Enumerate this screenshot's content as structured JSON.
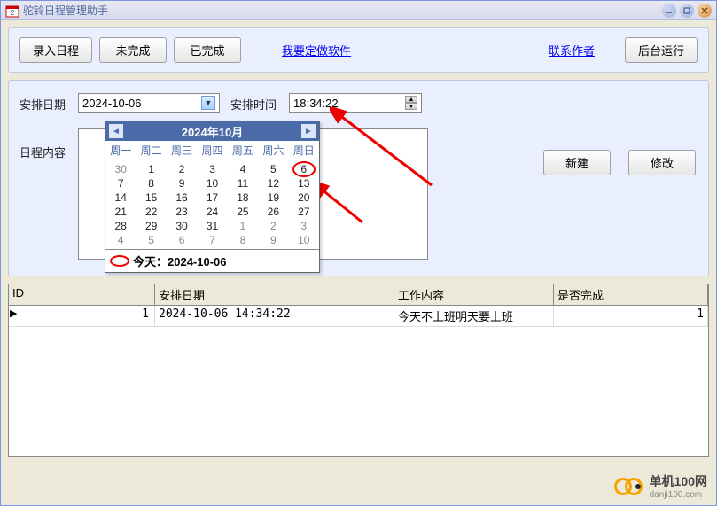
{
  "window": {
    "title": "驼铃日程管理助手"
  },
  "toolbar": {
    "input_schedule": "录入日程",
    "incomplete": "未完成",
    "complete": "已完成",
    "custom_sw": "我要定做软件",
    "contact": "联系作者",
    "background": "后台运行"
  },
  "form": {
    "date_label": "安排日期",
    "date_value": "2024-10-06",
    "time_label": "安排时间",
    "time_value": "18:34:22",
    "content_label": "日程内容",
    "new_btn": "新建",
    "edit_btn": "修改"
  },
  "calendar": {
    "title": "2024年10月",
    "weekdays": [
      "周一",
      "周二",
      "周三",
      "周四",
      "周五",
      "周六",
      "周日"
    ],
    "days": [
      {
        "n": "30",
        "other": true
      },
      {
        "n": "1"
      },
      {
        "n": "2"
      },
      {
        "n": "3"
      },
      {
        "n": "4"
      },
      {
        "n": "5"
      },
      {
        "n": "6",
        "selected": true
      },
      {
        "n": "7"
      },
      {
        "n": "8"
      },
      {
        "n": "9"
      },
      {
        "n": "10"
      },
      {
        "n": "11"
      },
      {
        "n": "12"
      },
      {
        "n": "13"
      },
      {
        "n": "14"
      },
      {
        "n": "15"
      },
      {
        "n": "16"
      },
      {
        "n": "17"
      },
      {
        "n": "18"
      },
      {
        "n": "19"
      },
      {
        "n": "20"
      },
      {
        "n": "21"
      },
      {
        "n": "22"
      },
      {
        "n": "23"
      },
      {
        "n": "24"
      },
      {
        "n": "25"
      },
      {
        "n": "26"
      },
      {
        "n": "27"
      },
      {
        "n": "28"
      },
      {
        "n": "29"
      },
      {
        "n": "30"
      },
      {
        "n": "31"
      },
      {
        "n": "1",
        "other": true
      },
      {
        "n": "2",
        "other": true
      },
      {
        "n": "3",
        "other": true
      },
      {
        "n": "4",
        "other": true
      },
      {
        "n": "5",
        "other": true
      },
      {
        "n": "6",
        "other": true
      },
      {
        "n": "7",
        "other": true
      },
      {
        "n": "8",
        "other": true
      },
      {
        "n": "9",
        "other": true
      },
      {
        "n": "10",
        "other": true
      }
    ],
    "today_label": "今天：2024-10-06"
  },
  "grid": {
    "headers": {
      "id": "ID",
      "date": "安排日期",
      "work": "工作内容",
      "done": "是否完成"
    },
    "rows": [
      {
        "id": "1",
        "date": "2024-10-06 14:34:22",
        "work": "今天不上班明天要上班",
        "done": "1"
      }
    ]
  },
  "watermark": {
    "name": "单机100网",
    "domain": "danji100.com"
  }
}
